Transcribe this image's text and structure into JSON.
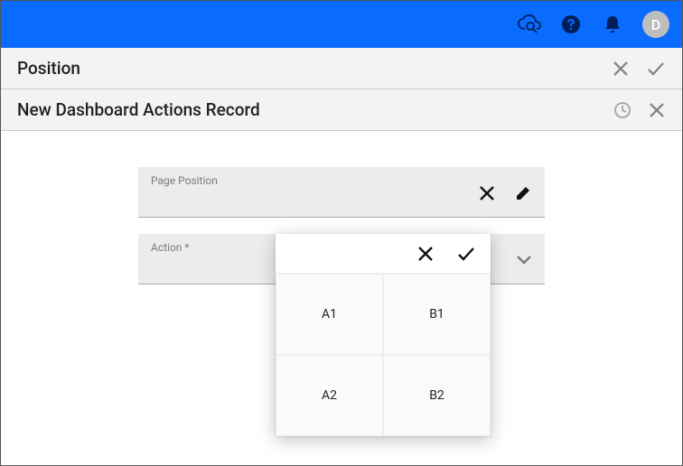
{
  "topbar": {
    "avatar_initial": "D"
  },
  "header1": {
    "title": "Position"
  },
  "header2": {
    "title": "New Dashboard Actions Record"
  },
  "fields": {
    "page_position_label": "Page Position",
    "action_label": "Action *"
  },
  "popup": {
    "cells": {
      "a1": "A1",
      "b1": "B1",
      "a2": "A2",
      "b2": "B2"
    }
  }
}
